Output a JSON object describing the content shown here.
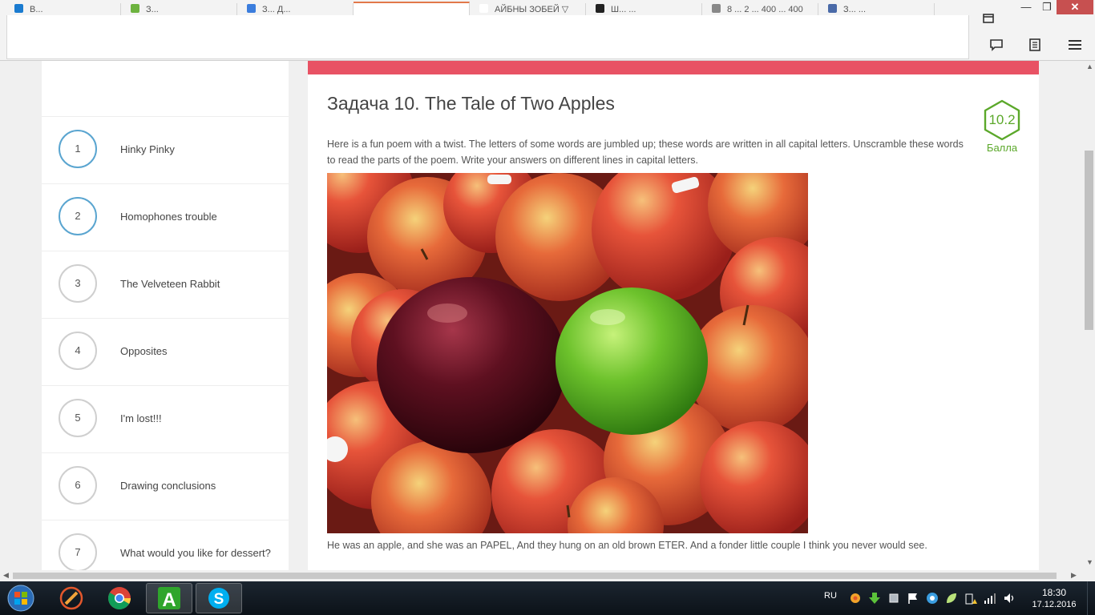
{
  "browser": {
    "tabs": [
      {
        "label": "В...",
        "color": "#1a7bd0"
      },
      {
        "label": "З...",
        "color": "#6db33f"
      },
      {
        "label": "З... Д...",
        "color": "#3b7ddd"
      },
      {
        "label": "",
        "color": "#ffffff"
      },
      {
        "label": "АЙБНЫ ЗОБЕЙ ▽",
        "color": "#ffffff"
      },
      {
        "label": "Ш... ...",
        "color": "#222222"
      },
      {
        "label": "8 ... 2 ... 400 ... 400",
        "color": "#888888"
      },
      {
        "label": "З... ...",
        "color": "#4a6aa8"
      }
    ]
  },
  "sidebar": {
    "items": [
      {
        "num": "1",
        "label": "Hinky Pinky",
        "done": true
      },
      {
        "num": "2",
        "label": "Homophones trouble",
        "done": true
      },
      {
        "num": "3",
        "label": "The Velveteen Rabbit",
        "done": false
      },
      {
        "num": "4",
        "label": "Opposites",
        "done": false
      },
      {
        "num": "5",
        "label": "I'm lost!!!",
        "done": false
      },
      {
        "num": "6",
        "label": "Drawing conclusions",
        "done": false
      },
      {
        "num": "7",
        "label": "What would you like for dessert?",
        "done": false
      }
    ]
  },
  "task": {
    "title": "Задача 10. The Tale of Two Apples",
    "score": "10.2",
    "score_label": "Балла",
    "intro": "Here is a fun poem with a twist. The letters of some words are jumbled up; these words are written in all capital letters. Unscramble these words to read the parts of the poem. Write your answers on different lines in capital letters.",
    "poem_line": "He was an apple, and she was an PAPEL, And they hung on an old brown ETER. And a fonder little couple I think you never would see."
  },
  "colors": {
    "accent_red": "#e85264",
    "score_green": "#5ba82a",
    "circle_blue": "#5aa5d0"
  },
  "taskbar": {
    "lang": "RU",
    "time": "18:30",
    "date": "17.12.2016"
  }
}
